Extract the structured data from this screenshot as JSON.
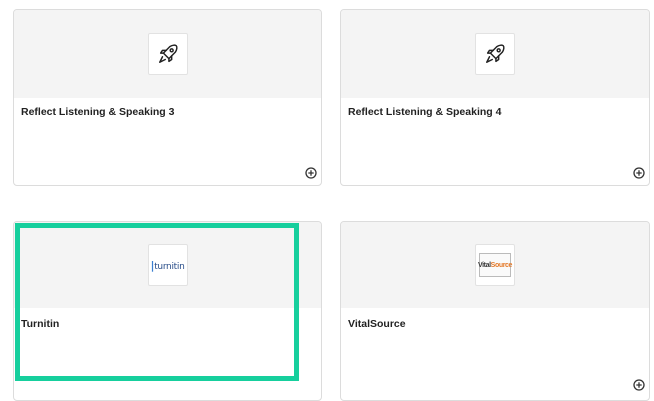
{
  "cards": [
    {
      "title": "Reflect Listening & Speaking 3",
      "icon": "rocket-icon"
    },
    {
      "title": "Reflect Listening & Speaking 4",
      "icon": "rocket-icon"
    },
    {
      "title": "Turnitin",
      "icon": "turnitin-logo",
      "logo_text": "turnitin"
    },
    {
      "title": "VitalSource",
      "icon": "vitalsource-logo",
      "logo_text_a": "Vital",
      "logo_text_b": "Source"
    }
  ],
  "colors": {
    "highlight": "#16cf9d",
    "card_top": "#f4f4f4",
    "card_border": "#dcdcdc"
  }
}
